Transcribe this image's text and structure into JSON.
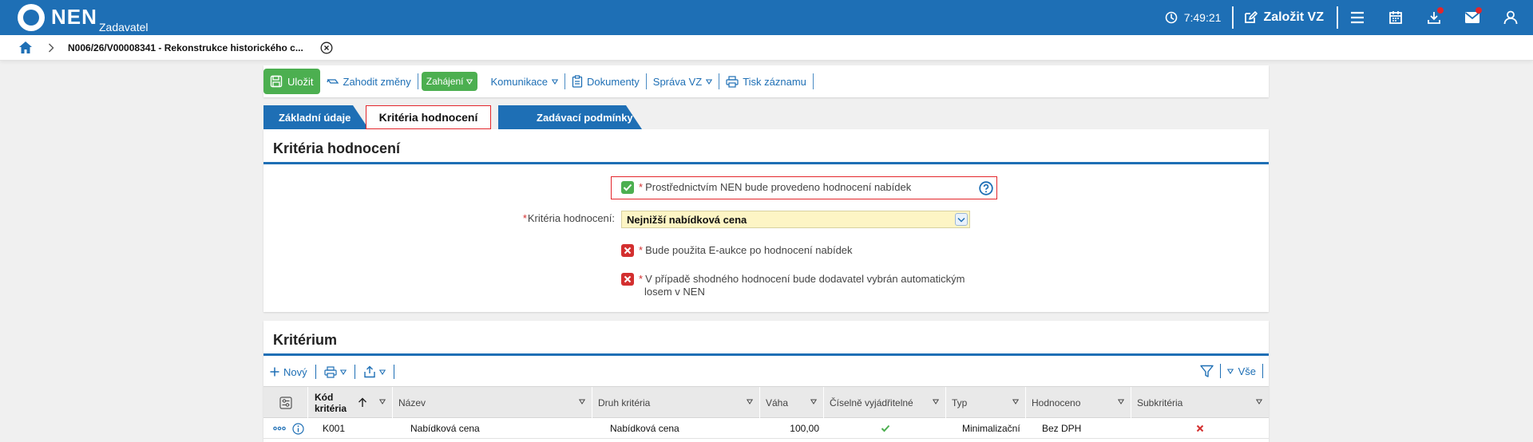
{
  "header": {
    "logo_text": "NEN",
    "role": "Zadavatel",
    "clock": "7:49:21",
    "create_label": "Založit VZ",
    "icons": [
      "menu-icon",
      "calendar-icon",
      "download-icon",
      "mail-icon",
      "user-icon"
    ],
    "notification_color": "#e3262b",
    "brand_color": "#1e6fb5"
  },
  "breadcrumb": {
    "title": "N006/26/V00008341 - Rekonstrukce historického c..."
  },
  "toolbar": {
    "save": "Uložit",
    "discard": "Zahodit změny",
    "start": "Zahájení",
    "communication": "Komunikace",
    "documents": "Dokumenty",
    "management": "Správa VZ",
    "print": "Tisk záznamu"
  },
  "tabs": [
    {
      "label": "Základní údaje",
      "active": false
    },
    {
      "label": "Kritéria hodnocení",
      "active": true
    },
    {
      "label": "Zadávací podmínky",
      "active": false
    }
  ],
  "criteria_panel": {
    "title": "Kritéria hodnocení",
    "nen_evaluation": {
      "label": "Prostřednictvím NEN bude provedeno hodnocení nabídek",
      "checked": true
    },
    "criteria_label": "Kritéria hodnocení:",
    "criteria_value": "Nejnižší nabídková cena",
    "eauction": {
      "label": "Bude použita E-aukce po hodnocení nabídek",
      "checked": false
    },
    "lottery": {
      "line1": "V případě shodného hodnocení bude dodavatel vybrán automatickým",
      "line2": "losem v NEN",
      "checked": false
    }
  },
  "criterion_panel": {
    "title": "Kritérium",
    "new_label": "Nový",
    "all_label": "Vše",
    "columns": [
      "Kód",
      "kritéria",
      "Název",
      "Druh kritéria",
      "Váha",
      "Číselně vyjádřitelné",
      "Typ",
      "Hodnoceno",
      "Subkritéria"
    ],
    "rows": [
      {
        "code": "K001",
        "name": "Nabídková cena",
        "kind": "Nabídková cena",
        "weight": "100,00",
        "numeric": true,
        "type": "Minimalizační",
        "evaluated": "Bez DPH",
        "subcriteria": false
      }
    ]
  }
}
